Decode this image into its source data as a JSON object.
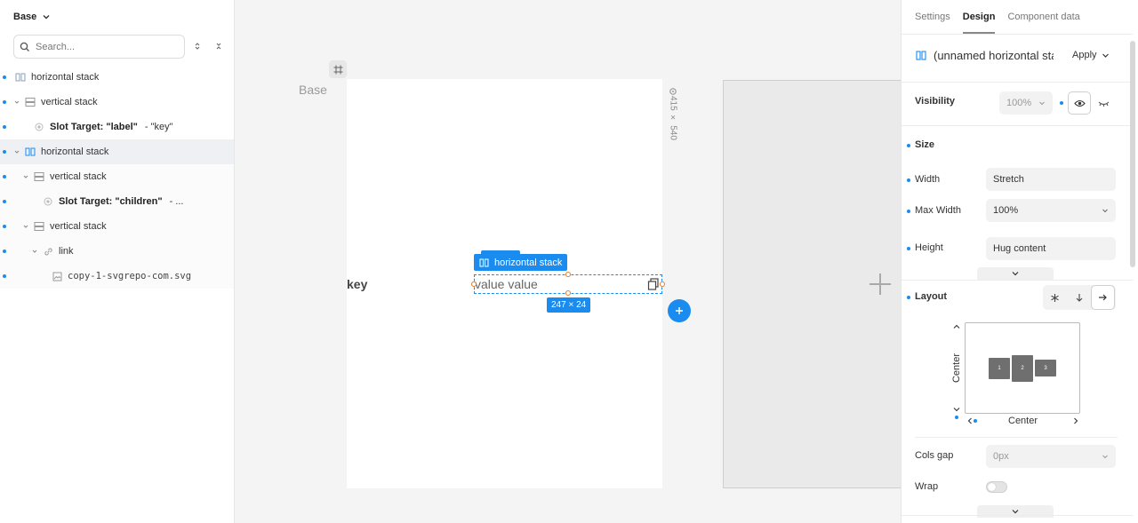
{
  "layers": {
    "title": "Base",
    "search_placeholder": "Search...",
    "items": [
      {
        "label": "horizontal stack"
      },
      {
        "label": "vertical stack"
      },
      {
        "label": "Slot Target: \"label\"",
        "sub": "- \"key\""
      },
      {
        "label": "horizontal stack"
      },
      {
        "label": "vertical stack"
      },
      {
        "label": "Slot Target: \"children\"",
        "sub": "- ..."
      },
      {
        "label": "vertical stack"
      },
      {
        "label": "link"
      },
      {
        "label": "copy-1-svgrepo-com.svg"
      }
    ]
  },
  "canvas": {
    "frame_name": "Base",
    "frame_size": "415 × 540",
    "key_text": "key",
    "value_text": "value value",
    "selection_label": "horizontal stack",
    "selection_size": "247 × 24"
  },
  "panel": {
    "tabs": [
      "Settings",
      "Design",
      "Component data"
    ],
    "component_title": "(unnamed horizontal stack)",
    "apply_label": "Apply",
    "visibility_label": "Visibility",
    "visibility_value": "100%",
    "size_label": "Size",
    "width_label": "Width",
    "width_value": "Stretch",
    "max_width_label": "Max Width",
    "max_width_value": "100%",
    "height_label": "Height",
    "height_value": "Hug content",
    "layout_label": "Layout",
    "align_vertical": "Center",
    "align_horizontal": "Center",
    "blocks": [
      "1",
      "2",
      "3"
    ],
    "cols_gap_label": "Cols gap",
    "cols_gap_value": "0px",
    "wrap_label": "Wrap"
  },
  "colors": {
    "accent": "#1a8cf0",
    "canvas_bg": "#f4f4f4"
  }
}
